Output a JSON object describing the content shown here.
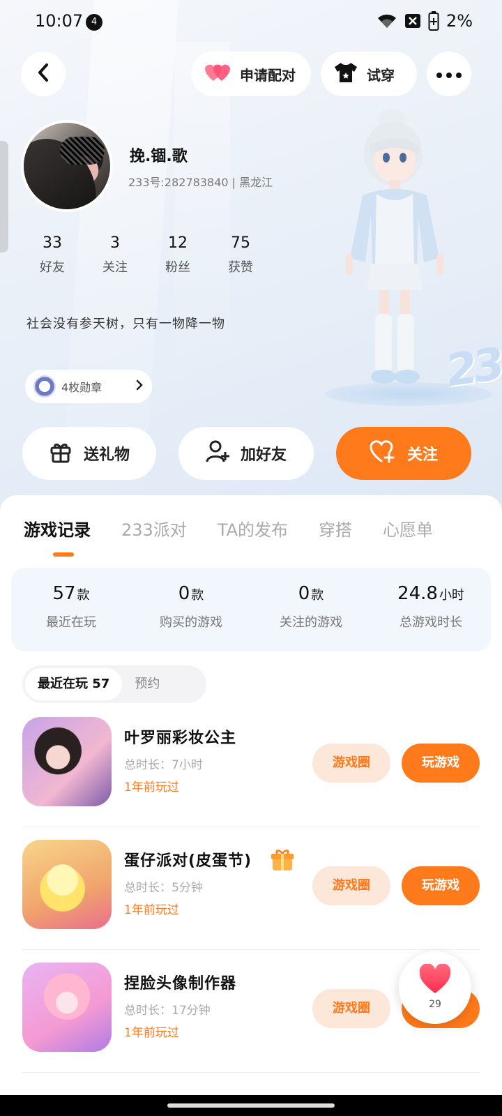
{
  "status_bar": {
    "time": "10:07",
    "notification_count": "4",
    "battery": "2%"
  },
  "nav": {
    "match_label": "申请配对",
    "tryon_label": "试穿"
  },
  "profile": {
    "nickname": "挽.锢.歌",
    "uid_line": "233号:282783840 | 黑龙江",
    "stats": [
      {
        "value": "33",
        "label": "好友"
      },
      {
        "value": "3",
        "label": "关注"
      },
      {
        "value": "12",
        "label": "粉丝"
      },
      {
        "value": "75",
        "label": "获赞"
      }
    ],
    "bio": "社会没有参天树，只有一物降一物",
    "badges_label": "4枚勋章"
  },
  "actions": {
    "gift": "送礼物",
    "add_friend": "加好友",
    "follow": "关注"
  },
  "tabs": [
    "游戏记录",
    "233派对",
    "TA的发布",
    "穿搭",
    "心愿单"
  ],
  "game_stats": [
    {
      "value": "57",
      "unit": "款",
      "label": "最近在玩"
    },
    {
      "value": "0",
      "unit": "款",
      "label": "购买的游戏"
    },
    {
      "value": "0",
      "unit": "款",
      "label": "关注的游戏"
    },
    {
      "value": "24.8",
      "unit": "小时",
      "label": "总游戏时长"
    }
  ],
  "sub_tabs": {
    "recent": "最近在玩 57",
    "reserve": "预约"
  },
  "games": [
    {
      "title": "叶罗丽彩妆公主",
      "duration": "总时长：7小时",
      "last": "1年前玩过",
      "circle_btn": "游戏圈",
      "play_btn": "玩游戏"
    },
    {
      "title": "蛋仔派对(皮蛋节)",
      "duration": "总时长：5分钟",
      "last": "1年前玩过",
      "circle_btn": "游戏圈",
      "play_btn": "玩游戏"
    },
    {
      "title": "捏脸头像制作器",
      "duration": "总时长：17分钟",
      "last": "1年前玩过",
      "circle_btn": "游戏圈",
      "play_btn": "玩游戏"
    }
  ],
  "like_float": {
    "count": "29"
  },
  "colors": {
    "accent": "#ff7a1a",
    "accent_light": "#fde7d9"
  }
}
